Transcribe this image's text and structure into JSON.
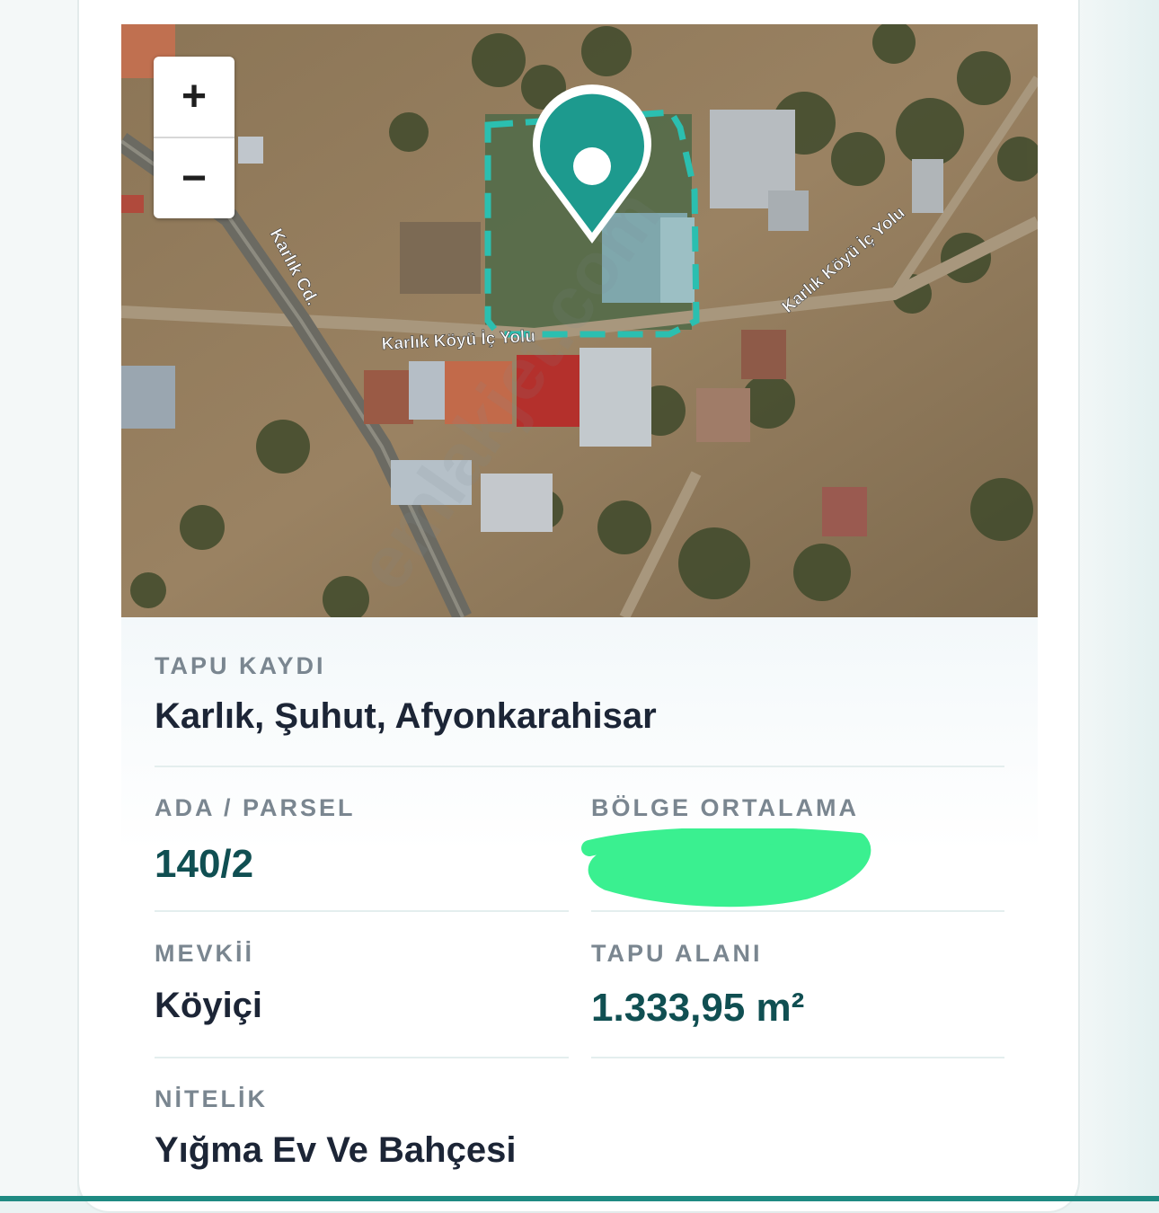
{
  "map": {
    "zoom_in_label": "+",
    "zoom_out_label": "−",
    "street_labels": {
      "karlik_cd": "Karlık Cd.",
      "ic_yolu_center": "Karlık Köyü İç Yolu",
      "ic_yolu_right": "Karlık Köyü İç Yolu"
    },
    "watermark": "emlakjet.com",
    "colors": {
      "pin": "#1d9a8e",
      "parcel_outline": "#2bbfb0"
    }
  },
  "details": {
    "tapu_kaydi": {
      "label": "TAPU KAYDI",
      "value": "Karlık, Şuhut, Afyonkarahisar"
    },
    "ada_parsel": {
      "label": "ADA / PARSEL",
      "value": "140/2"
    },
    "bolge_ortalama": {
      "label": "BÖLGE ORTALAMA",
      "value": ""
    },
    "mevkii": {
      "label": "MEVKİİ",
      "value": "Köyiçi"
    },
    "tapu_alani": {
      "label": "TAPU ALANI",
      "value": "1.333,95 m²"
    },
    "nitelik": {
      "label": "NİTELİK",
      "value": "Yığma Ev Ve Bahçesi"
    }
  },
  "colors": {
    "accent": "#104f52",
    "label": "#7a8690",
    "redaction": "#3af090"
  }
}
